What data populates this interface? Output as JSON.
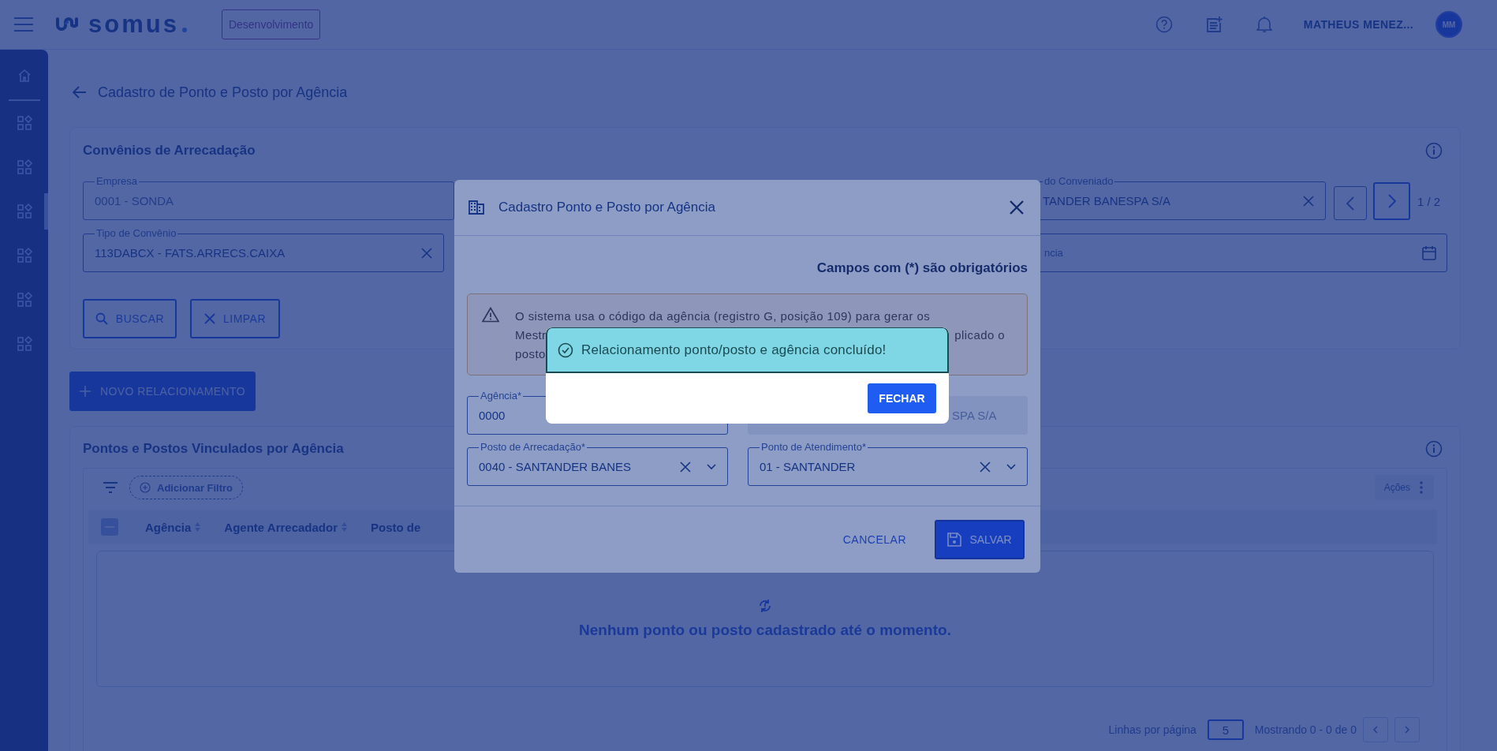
{
  "topbar": {
    "logo": "somus",
    "environment": "Desenvolvimento",
    "user": "MATHEUS MENEZ...",
    "avatar": "MM"
  },
  "sidebar": {
    "items": [
      {
        "kind": "home",
        "selected": false
      },
      {
        "kind": "apps",
        "selected": false
      },
      {
        "kind": "apps",
        "selected": false
      },
      {
        "kind": "apps",
        "selected": true
      },
      {
        "kind": "apps",
        "selected": false
      },
      {
        "kind": "apps",
        "selected": false
      },
      {
        "kind": "apps",
        "selected": false
      }
    ]
  },
  "page_title": "Cadastro de Ponto e Posto por Agência",
  "convenios": {
    "title": "Convênios de Arrecadação",
    "empresa": {
      "label": "Empresa",
      "value": "0001 - SONDA",
      "disabled": true
    },
    "conveniado": {
      "label": "do Conveniado",
      "value": "TANDER BANESPA S/A"
    },
    "pager": "1 / 2",
    "tipo": {
      "label": "Tipo de Convênio",
      "value": "113DABCX - FATS.ARRECS.CAIXA"
    },
    "date_field": {
      "placeholder": "ncia"
    },
    "search_button": "BUSCAR",
    "clear_button": "LIMPAR"
  },
  "new_button": "NOVO RELACIONAMENTO",
  "vinculados": {
    "title": "Pontos e Postos Vinculados por Agência",
    "filter_button": "Adicionar Filtro",
    "actions": "Ações",
    "select_all": {
      "indeterminate": true
    },
    "columns": [
      "Agência",
      "Agente Arrecadador",
      "Posto de"
    ],
    "empty_message": "Nenhum ponto ou posto cadastrado até o momento.",
    "rows_per_page_label": "Linhas por página",
    "rows_per_page": "5",
    "range": "Mostrando 0 - 0 de 0"
  },
  "modal": {
    "title": "Cadastro Ponto e Posto por Agência",
    "required_note": "Campos com (*) são obrigatórios",
    "warning": {
      "line_1": "O sistema usa o código da agência (registro G, posição 109) para gerar os",
      "line_2_start": "Mestr",
      "line_2_end": "plicado o",
      "line_3": "posto"
    },
    "fields": [
      {
        "kind": "text",
        "label": "Agência*",
        "value": "0000",
        "disabled": false
      },
      {
        "kind": "text",
        "value": "SPA S/A",
        "disabled": true
      },
      {
        "kind": "select",
        "label": "Posto de Arrecadação*",
        "value": "0040 - SANTANDER BANES",
        "disabled": false
      },
      {
        "kind": "select",
        "label": "Ponto de Atendimento*",
        "value": "01 - SANTANDER",
        "disabled": false
      }
    ],
    "cancel_button": "CANCELAR",
    "save_button": "SALVAR"
  },
  "success_dialog": {
    "message": "Relacionamento ponto/posto e agência concluído!",
    "button": "FECHAR"
  }
}
